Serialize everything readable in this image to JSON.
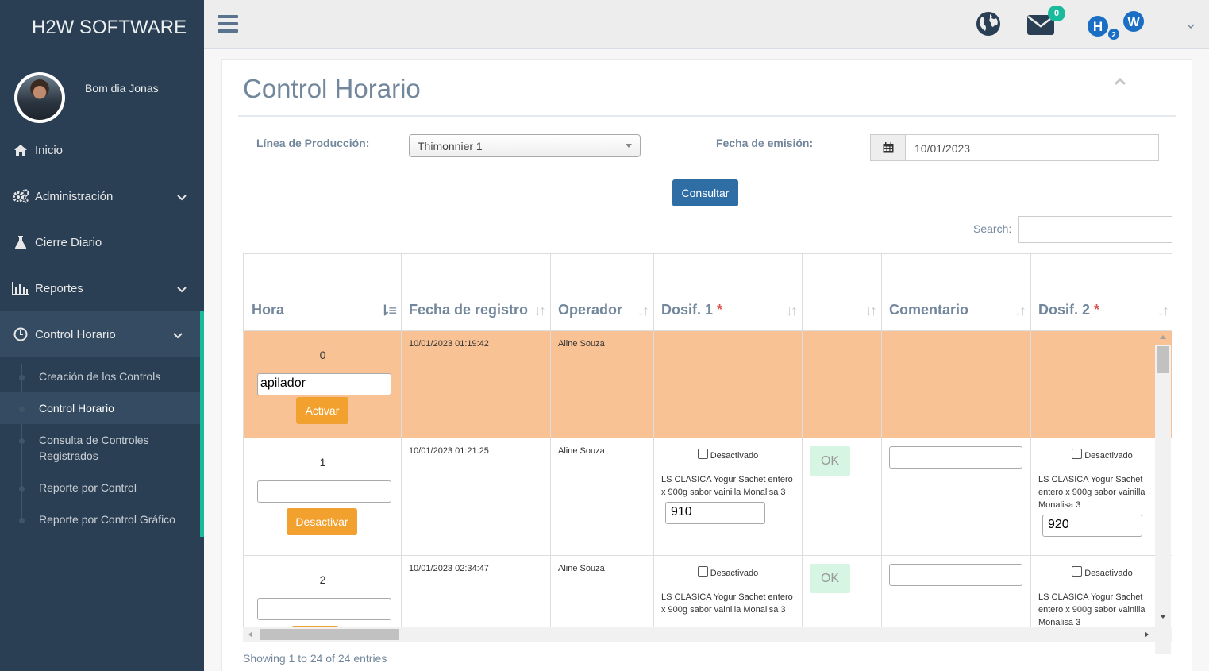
{
  "brand": "H2W SOFTWARE",
  "profile": {
    "greeting": "Bom dia Jonas"
  },
  "nav": [
    {
      "label": "Inicio",
      "icon": "home-icon"
    },
    {
      "label": "Administración",
      "icon": "gears-icon"
    },
    {
      "label": "Cierre Diario",
      "icon": "flask-icon"
    },
    {
      "label": "Reportes",
      "icon": "bar-chart-icon"
    },
    {
      "label": "Control Horario",
      "icon": "clock-icon"
    }
  ],
  "submenu": [
    "Creación de los Controls",
    "Control Horario",
    "Consulta de Controles Registrados",
    "Reporte por Control",
    "Reporte por Control Gráfico"
  ],
  "topbar": {
    "mail_count": "0"
  },
  "page": {
    "title": "Control Horario",
    "line_label": "Línea de Producción:",
    "line_value": "Thimonnier 1",
    "date_label": "Fecha de emisión:",
    "date_value": "10/01/2023",
    "consult_button": "Consultar",
    "search_label": "Search:",
    "info": "Showing 1 to 24 of 24 entries"
  },
  "table": {
    "headers": [
      "Hora",
      "Fecha de registro",
      "Operador",
      "Dosif. 1",
      "",
      "Comentario",
      "Dosif. 2"
    ],
    "required_mark": "*",
    "rows": [
      {
        "hora": "0",
        "hora_input": "apilador",
        "action": "Activar",
        "fecha": "10/01/2023 01:19:42",
        "operador": "Aline Souza"
      },
      {
        "hora": "1",
        "hora_input": "",
        "action": "Desactivar",
        "fecha": "10/01/2023 01:21:25",
        "operador": "Aline Souza",
        "dosif1": {
          "checkbox": "Desactivado",
          "product": "LS CLASICA Yogur Sachet entero x 900g sabor vainilla Monalisa 3",
          "value": "910"
        },
        "status": "OK",
        "dosif2": {
          "checkbox": "Desactivado",
          "product": "LS CLASICA Yogur Sachet entero x 900g sabor vainilla Monalisa 3",
          "value": "920"
        }
      },
      {
        "hora": "2",
        "hora_input": "",
        "fecha": "10/01/2023 02:34:47",
        "operador": "Aline Souza",
        "dosif1": {
          "checkbox": "Desactivado",
          "product": "LS CLASICA Yogur Sachet entero x 900g sabor vainilla Monalisa 3"
        },
        "status": "OK",
        "dosif2": {
          "checkbox": "Desactivado",
          "product": "LS CLASICA Yogur Sachet entero x 900g sabor vainilla Monalisa 3"
        }
      }
    ]
  },
  "colors": {
    "sidebar": "#2a3f54",
    "accent": "#1abb9c",
    "warn_row": "#f8c295",
    "primary": "#2f6da5",
    "warning": "#f3a12e"
  }
}
